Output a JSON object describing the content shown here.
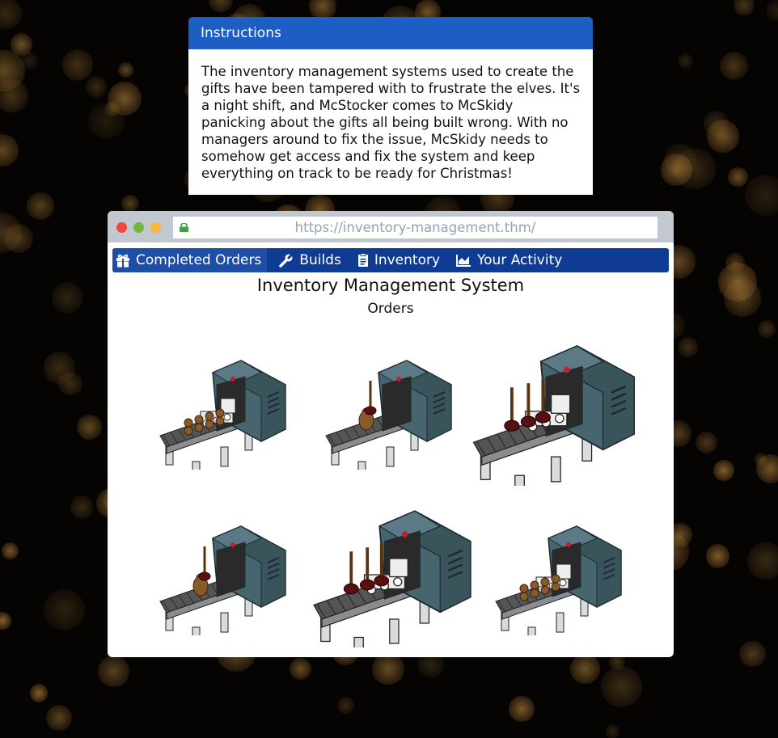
{
  "instructions": {
    "heading": "Instructions",
    "body": "The inventory management systems used to create the gifts have been tampered with to frustrate the elves. It's a night shift, and McStocker comes to McSkidy panicking about the gifts all being built wrong. With no managers around to fix the issue, McSkidy needs to somehow get access and fix the system and keep everything on track to be ready for Christmas!"
  },
  "browser": {
    "url": "https://inventory-management.thm/",
    "nav": [
      {
        "label": "Completed Orders",
        "icon": "gift-icon",
        "active": true
      },
      {
        "label": "Builds",
        "icon": "wrench-icon",
        "active": false
      },
      {
        "label": "Inventory",
        "icon": "clipboard-icon",
        "active": false
      },
      {
        "label": "Your Activity",
        "icon": "chart-icon",
        "active": false
      }
    ]
  },
  "page": {
    "title": "Inventory Management System",
    "subtitle": "Orders"
  },
  "orders": [
    {
      "item": "train-with-gingerbread"
    },
    {
      "item": "gingerbread-with-plunger"
    },
    {
      "item": "train-with-plungers"
    },
    {
      "item": "gingerbread-with-plunger"
    },
    {
      "item": "train-with-plungers"
    },
    {
      "item": "train-with-gingerbread"
    }
  ],
  "colors": {
    "header_blue": "#1d5ec4",
    "nav_blue": "#0e3b94",
    "machine_teal": "#47656f",
    "conveyor_gray": "#6a6a6a"
  }
}
